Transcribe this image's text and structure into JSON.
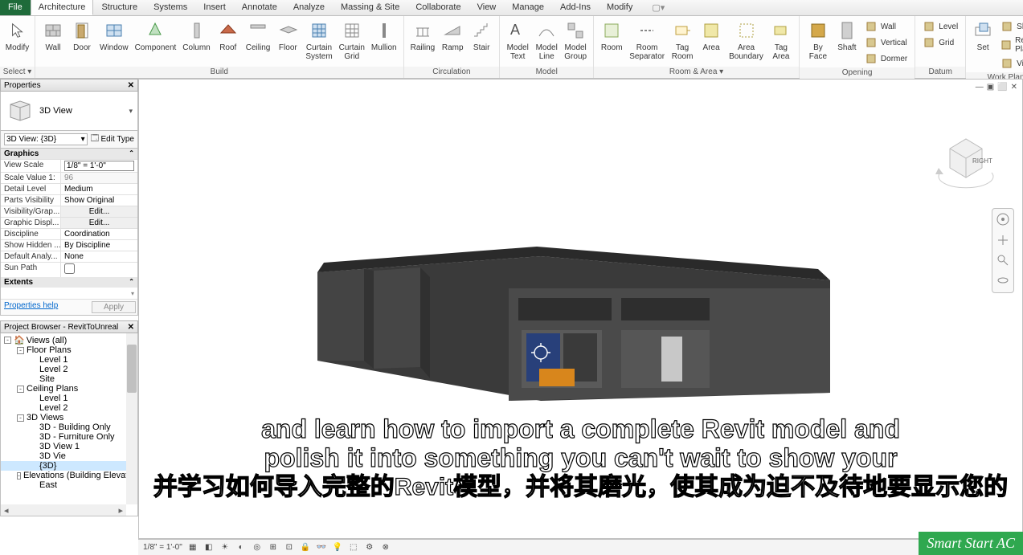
{
  "tabs": {
    "file": "File",
    "items": [
      "Architecture",
      "Structure",
      "Systems",
      "Insert",
      "Annotate",
      "Analyze",
      "Massing & Site",
      "Collaborate",
      "View",
      "Manage",
      "Add-Ins",
      "Modify"
    ],
    "active": "Architecture"
  },
  "ribbon": {
    "select": {
      "modify": "Modify",
      "select": "Select"
    },
    "build": {
      "label": "Build",
      "items": [
        "Wall",
        "Door",
        "Window",
        "Component",
        "Column",
        "Roof",
        "Ceiling",
        "Floor",
        "Curtain System",
        "Curtain Grid",
        "Mullion"
      ]
    },
    "circulation": {
      "label": "Circulation",
      "items": [
        "Railing",
        "Ramp",
        "Stair"
      ]
    },
    "model": {
      "label": "Model",
      "items": [
        "Model Text",
        "Model Line",
        "Model Group"
      ]
    },
    "room_area": {
      "label": "Room & Area",
      "items": [
        "Room",
        "Room Separator",
        "Tag Room",
        "Area",
        "Area Boundary",
        "Tag Area"
      ]
    },
    "opening": {
      "label": "Opening",
      "by_face": "By Face",
      "shaft": "Shaft",
      "small": [
        "Wall",
        "Vertical",
        "Dormer"
      ]
    },
    "datum": {
      "label": "Datum",
      "small": [
        "Level",
        "Grid"
      ]
    },
    "work_plane": {
      "label": "Work Plane",
      "set": "Set",
      "small": [
        "Show",
        "Ref. Plane",
        "Viewer"
      ]
    }
  },
  "properties": {
    "title": "Properties",
    "type_name": "3D View",
    "view_label": "3D View: {3D}",
    "edit_type": "Edit Type",
    "sections": {
      "graphics": "Graphics",
      "rows": [
        {
          "k": "View Scale",
          "v": "1/8\" = 1'-0\"",
          "editable": true
        },
        {
          "k": "Scale Value  1:",
          "v": "96",
          "gray": true
        },
        {
          "k": "Detail Level",
          "v": "Medium"
        },
        {
          "k": "Parts Visibility",
          "v": "Show Original"
        },
        {
          "k": "Visibility/Grap...",
          "v": "Edit...",
          "btn": true
        },
        {
          "k": "Graphic Displ...",
          "v": "Edit...",
          "btn": true
        },
        {
          "k": "Discipline",
          "v": "Coordination"
        },
        {
          "k": "Show Hidden ...",
          "v": "By Discipline"
        },
        {
          "k": "Default Analy...",
          "v": "None"
        },
        {
          "k": "Sun Path",
          "v": "",
          "check": true
        }
      ],
      "extents": "Extents"
    },
    "help": "Properties help",
    "apply": "Apply"
  },
  "browser": {
    "title": "Project Browser - RevitToUnreal",
    "tree": [
      {
        "d": 0,
        "exp": "-",
        "icon": true,
        "t": "Views (all)"
      },
      {
        "d": 1,
        "exp": "-",
        "t": "Floor Plans"
      },
      {
        "d": 2,
        "t": "Level 1"
      },
      {
        "d": 2,
        "t": "Level 2"
      },
      {
        "d": 2,
        "t": "Site"
      },
      {
        "d": 1,
        "exp": "-",
        "t": "Ceiling Plans"
      },
      {
        "d": 2,
        "t": "Level 1"
      },
      {
        "d": 2,
        "t": "Level 2"
      },
      {
        "d": 1,
        "exp": "-",
        "t": "3D Views"
      },
      {
        "d": 2,
        "t": "3D - Building Only"
      },
      {
        "d": 2,
        "t": "3D - Furniture Only"
      },
      {
        "d": 2,
        "t": "3D View 1"
      },
      {
        "d": 2,
        "t": "3D Vie"
      },
      {
        "d": 2,
        "t": "{3D}",
        "sel": true
      },
      {
        "d": 1,
        "exp": "-",
        "t": "Elevations (Building Elevation"
      },
      {
        "d": 2,
        "t": "East"
      }
    ]
  },
  "view_cube": {
    "face": "RIGHT"
  },
  "status": {
    "scale": "1/8\" = 1'-0\""
  },
  "subtitles": {
    "en1": "and learn how to import a complete Revit model and",
    "en2": "polish it into something you can't wait to show your",
    "zh": "并学习如何导入完整的Revit模型，并将其磨光，使其成为迫不及待地要显示您的"
  },
  "watermark": "Smart Start AC"
}
